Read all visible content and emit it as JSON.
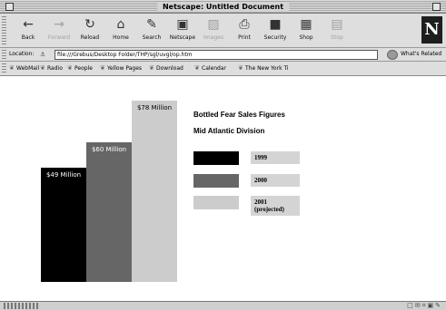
{
  "window": {
    "title": "Netscape: Untitled Document"
  },
  "toolbar": {
    "buttons": [
      {
        "label": "Back",
        "icon": "back-arrow-icon",
        "enabled": true
      },
      {
        "label": "Forward",
        "icon": "forward-arrow-icon",
        "enabled": false
      },
      {
        "label": "Reload",
        "icon": "reload-icon",
        "enabled": true
      },
      {
        "label": "Home",
        "icon": "home-icon",
        "enabled": true
      },
      {
        "label": "Search",
        "icon": "search-icon",
        "enabled": true
      },
      {
        "label": "Netscape",
        "icon": "netscape-icon",
        "enabled": true
      },
      {
        "label": "Images",
        "icon": "images-icon",
        "enabled": false
      },
      {
        "label": "Print",
        "icon": "print-icon",
        "enabled": true
      },
      {
        "label": "Security",
        "icon": "security-icon",
        "enabled": true
      },
      {
        "label": "Shop",
        "icon": "shop-icon",
        "enabled": true
      },
      {
        "label": "Stop",
        "icon": "stop-icon",
        "enabled": false
      }
    ],
    "logo": "N"
  },
  "location": {
    "label": "Location:",
    "url": "file:///Grebus/Desktop Folder/THP/sgl/uvgl/op.htm",
    "related_label": "What's Related"
  },
  "personal_toolbar": {
    "items": [
      "WebMail",
      "Radio",
      "People",
      "Yellow Pages",
      "Download",
      "Calendar",
      "The New York Ti"
    ]
  },
  "chart": {
    "title": "Bottled Fear Sales Figures",
    "subtitle": "Mid Atlantic Division"
  },
  "chart_data": {
    "type": "bar",
    "title": "Bottled Fear Sales Figures",
    "subtitle": "Mid Atlantic Division",
    "categories": [
      "1999",
      "2000",
      "2001\n(projected)"
    ],
    "values": [
      49,
      60,
      78
    ],
    "value_labels": [
      "$49 Million",
      "$60 Million",
      "$78 Million"
    ],
    "colors": [
      "#000000",
      "#666666",
      "#cccccc"
    ],
    "legend": {
      "placement": "right",
      "entries": [
        "1999",
        "2000",
        "2001\n(projected)"
      ]
    },
    "ylim": [
      0,
      78
    ],
    "grid": false,
    "axes_visible": false
  }
}
